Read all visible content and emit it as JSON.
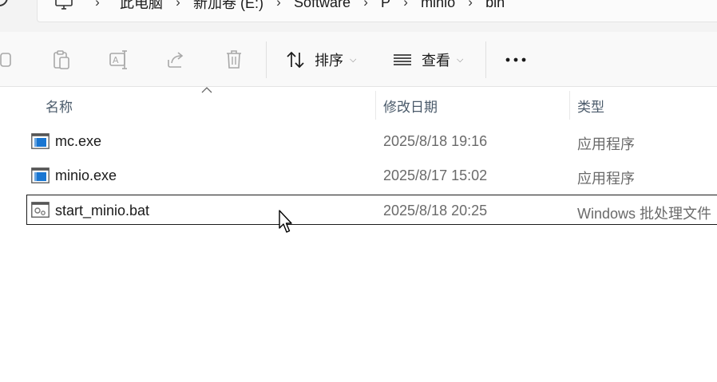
{
  "address_bar": {
    "breadcrumbs": [
      "此电脑",
      "新加卷 (E:)",
      "Software",
      "P",
      "minio",
      "bin"
    ],
    "separator_icon": "chevron-right-icon",
    "root_icon": "computer-icon"
  },
  "toolbar": {
    "disabled_icons": [
      "copy-icon",
      "paste-icon",
      "rename-icon",
      "share-icon",
      "delete-icon"
    ],
    "sort_label": "排序",
    "view_label": "查看",
    "more_icon": "more-options-icon"
  },
  "columns": {
    "name": "名称",
    "date_modified": "修改日期",
    "type": "类型"
  },
  "files": [
    {
      "name": "mc.exe",
      "date": "2025/8/18 19:16",
      "type": "应用程序",
      "icon": "application-icon"
    },
    {
      "name": "minio.exe",
      "date": "2025/8/17 15:02",
      "type": "应用程序",
      "icon": "application-icon"
    },
    {
      "name": "start_minio.bat",
      "date": "2025/8/18 20:25",
      "type": "Windows 批处理文件",
      "icon": "batch-file-icon",
      "selected": true
    }
  ],
  "colors": {
    "toolbar_bg": "#f9f9f9",
    "address_bg": "#f3f3f3",
    "header_text": "#4a5a6a",
    "secondary_text": "#6a6a6a",
    "disabled_icon": "#a8a8a8",
    "app_icon_blue": "#1976d2"
  }
}
